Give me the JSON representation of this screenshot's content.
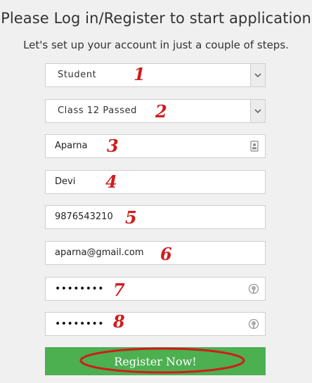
{
  "header": {
    "title": "Please Log in/Register to start application",
    "subtitle": "Let's set up your account in just a couple of steps."
  },
  "form": {
    "user_type": "Student",
    "qualification": "Class 12 Passed",
    "first_name": "Aparna",
    "last_name": "Devi",
    "mobile": "9876543210",
    "email": "aparna@gmail.com",
    "password_mask": "••••••••",
    "confirm_password_mask": "••••••••",
    "register_label": "Register Now!"
  },
  "annotations": [
    "1",
    "2",
    "3",
    "4",
    "5",
    "6",
    "7",
    "8"
  ],
  "colors": {
    "button": "#4caf50",
    "annotation": "#d01c1c"
  },
  "icons": {
    "select_arrow": "chevron-down-icon",
    "contact_card": "contact-card-icon",
    "password_reveal": "eye-icon"
  }
}
